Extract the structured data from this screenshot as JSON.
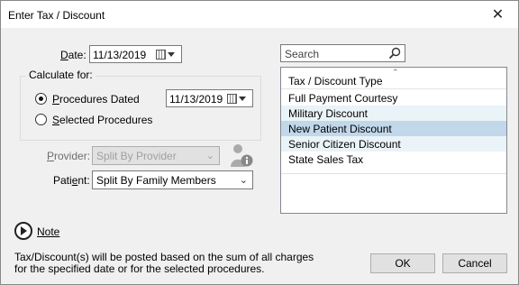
{
  "window": {
    "title": "Enter Tax / Discount",
    "close_glyph": "✕"
  },
  "date": {
    "label": "Date:",
    "value": "11/13/2019"
  },
  "calculate_for": {
    "label": "Calculate for:",
    "procedures_dated": {
      "label": "Procedures Dated",
      "selected": true,
      "date": "11/13/2019"
    },
    "selected_procedures": {
      "label": "Selected Procedures",
      "selected": false
    }
  },
  "provider": {
    "label": "Provider:",
    "value": "Split By Provider",
    "disabled": true
  },
  "patient": {
    "label": "Patient:",
    "value": "Split By Family Members"
  },
  "search": {
    "placeholder": "Search"
  },
  "grid": {
    "header": "Tax / Discount Type",
    "rows": [
      {
        "label": "Full Payment Courtesy",
        "state": "normal"
      },
      {
        "label": "Military Discount",
        "state": "alt"
      },
      {
        "label": "New Patient Discount",
        "state": "selected"
      },
      {
        "label": "Senior Citizen Discount",
        "state": "alt"
      },
      {
        "label": "State Sales Tax",
        "state": "normal"
      }
    ]
  },
  "note": {
    "label": "Note"
  },
  "footer_text": "Tax/Discount(s) will be posted based on the sum of all charges for the specified date or for the selected procedures.",
  "buttons": {
    "ok": "OK",
    "cancel": "Cancel"
  },
  "icons": {
    "calendar": "calendar-icon",
    "search": "search-icon",
    "info": "info-icon",
    "play": "play-icon"
  },
  "colors": {
    "selected_row": "#c1d7ea",
    "alt_row": "#eaf3f7"
  }
}
